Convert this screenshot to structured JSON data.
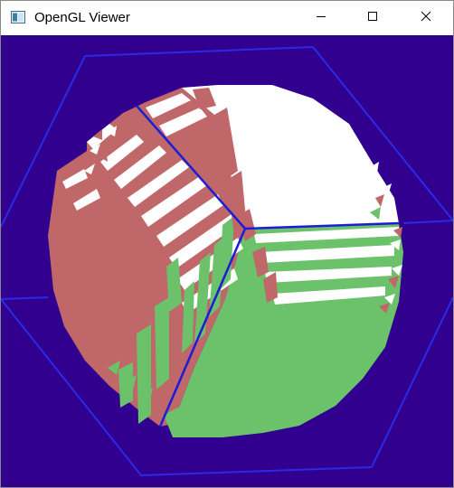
{
  "window": {
    "title": "OpenGL Viewer"
  },
  "icons": {
    "app": "app-window-icon",
    "minimize": "minimize-icon",
    "maximize": "maximize-icon",
    "close": "close-icon"
  },
  "colors": {
    "background": "#31008e",
    "bounding_box": "#2a2ae8",
    "axis": "#1c1cd8",
    "face_top": "#ffffff",
    "face_left": "#c0676a",
    "face_right": "#6cc26a"
  }
}
